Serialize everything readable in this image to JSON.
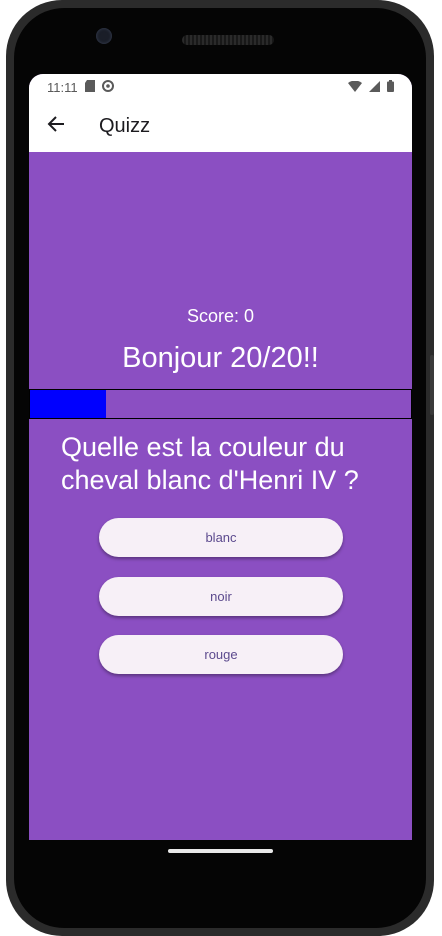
{
  "status_bar": {
    "time": "11:11",
    "left_icons": [
      "sd-card-icon",
      "sync-icon"
    ],
    "right_icons": [
      "wifi-icon",
      "signal-icon",
      "battery-icon"
    ]
  },
  "app_bar": {
    "back_icon": "arrow-left-icon",
    "title": "Quizz"
  },
  "quiz": {
    "score_text": "Score: 0",
    "greeting": "Bonjour 20/20!!",
    "progress": 0.2,
    "question": "Quelle est la couleur du cheval blanc d'Henri IV ?",
    "answers": [
      "blanc",
      "noir",
      "rouge"
    ]
  },
  "colors": {
    "background": "#8b4fc2",
    "progress_fill": "#0000ff",
    "answer_button": "#f7f0f7",
    "answer_text": "#5c4a8e"
  }
}
